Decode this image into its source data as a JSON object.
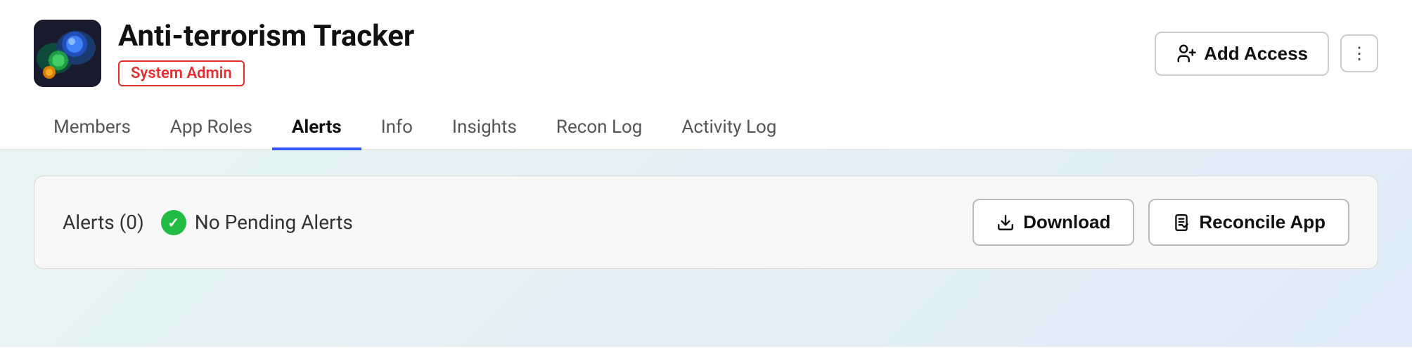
{
  "header": {
    "app_title": "Anti-terrorism Tracker",
    "badge_label": "System Admin",
    "add_access_label": "Add Access",
    "more_icon": "⋮"
  },
  "nav": {
    "tabs": [
      {
        "id": "members",
        "label": "Members",
        "active": false
      },
      {
        "id": "app-roles",
        "label": "App Roles",
        "active": false
      },
      {
        "id": "alerts",
        "label": "Alerts",
        "active": true
      },
      {
        "id": "info",
        "label": "Info",
        "active": false
      },
      {
        "id": "insights",
        "label": "Insights",
        "active": false
      },
      {
        "id": "recon-log",
        "label": "Recon Log",
        "active": false
      },
      {
        "id": "activity-log",
        "label": "Activity Log",
        "active": false
      }
    ]
  },
  "alerts_card": {
    "count_label": "Alerts (0)",
    "status_text": "No Pending Alerts",
    "download_label": "Download",
    "reconcile_label": "Reconcile App",
    "download_icon": "⬇",
    "reconcile_icon": "📋"
  }
}
